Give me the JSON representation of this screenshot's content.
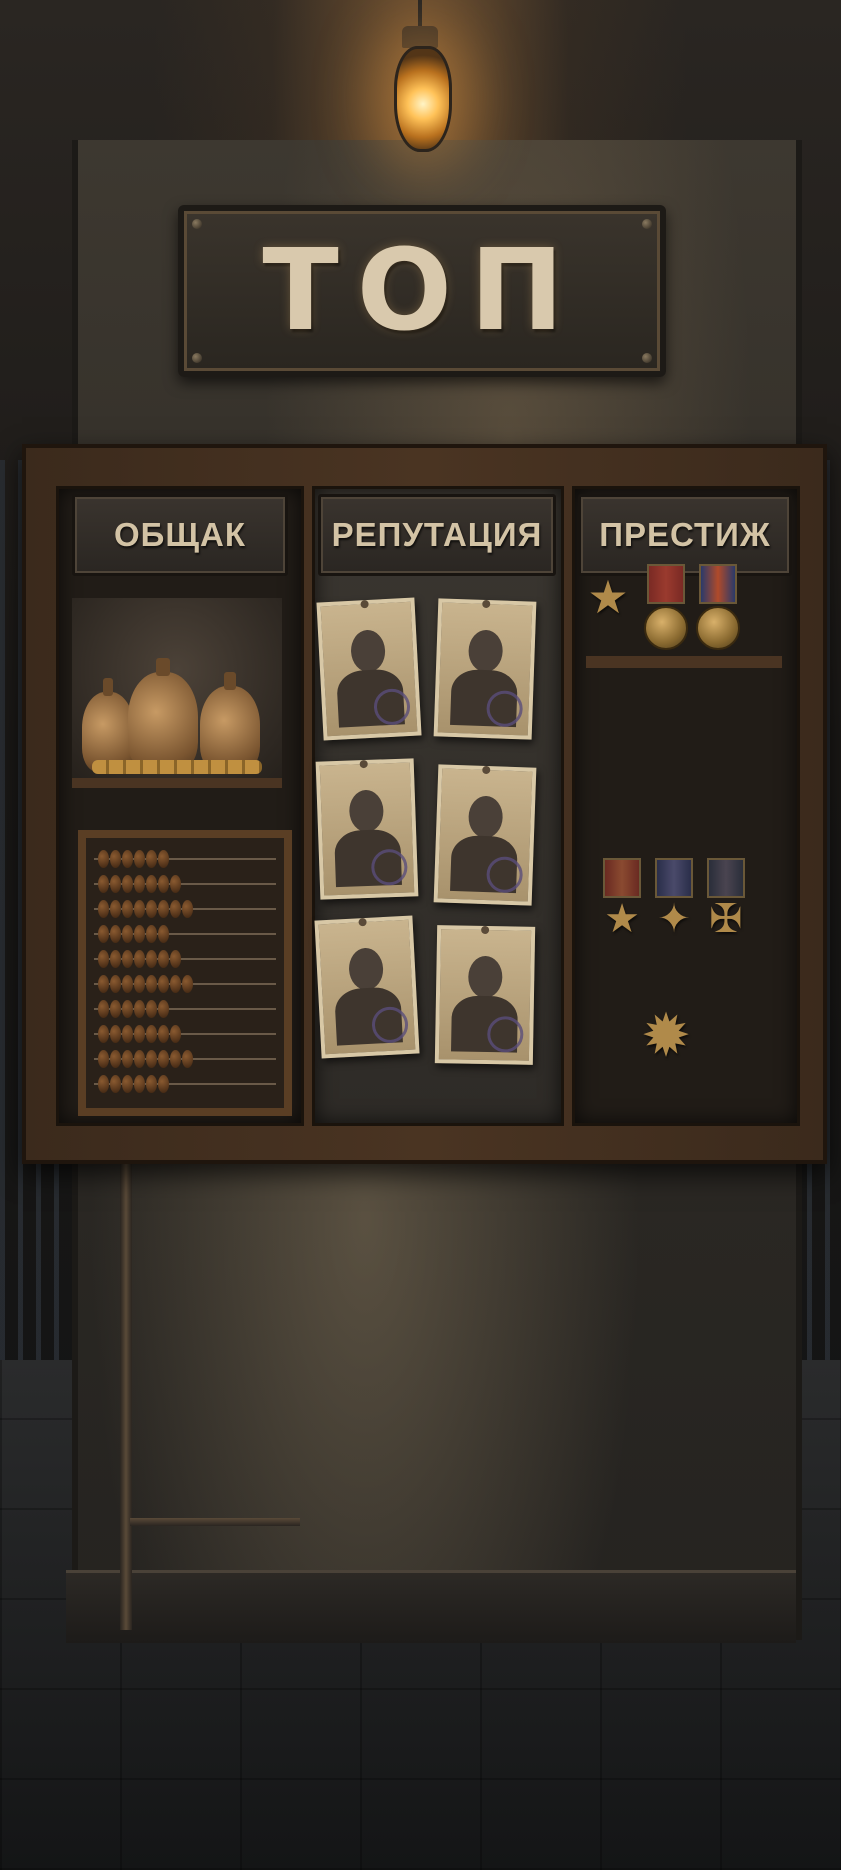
{
  "board": {
    "title": "ТОП",
    "categories": [
      {
        "key": "obshchak",
        "label": "ОБЩАК"
      },
      {
        "key": "reputation",
        "label": "РЕПУТАЦИЯ"
      },
      {
        "key": "prestige",
        "label": "ПРЕСТИЖ"
      }
    ]
  },
  "icons": {
    "lamp": "ceiling-lamp-icon",
    "money_bag": "money-bag-icon",
    "coins": "coin-stack-icon",
    "abacus": "abacus-icon",
    "mugshot": "mugshot-photo-icon",
    "medal": "medal-icon",
    "order": "star-order-icon"
  },
  "colors": {
    "lamp_glow": "#ffc258",
    "sign_text": "#d9c9ad",
    "wood": "#4a3422",
    "photo_paper": "#c9b48e",
    "stamp_ink": "#5a4e7a"
  }
}
